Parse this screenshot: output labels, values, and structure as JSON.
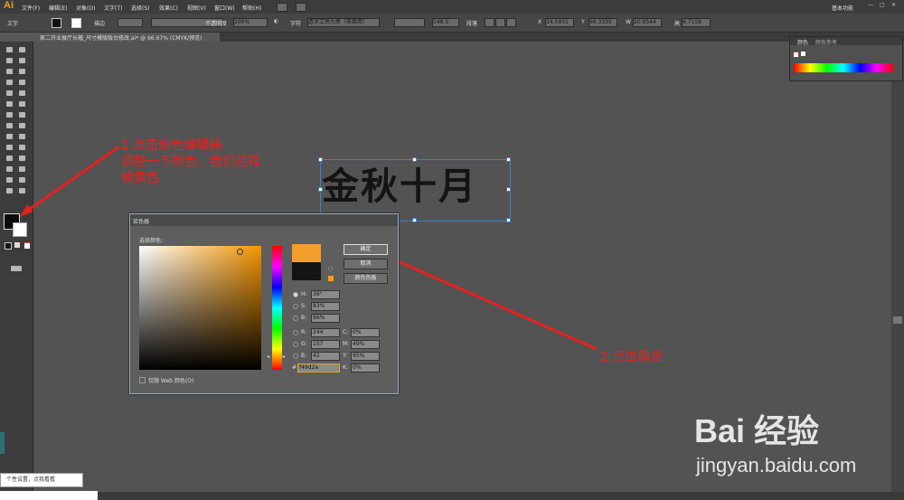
{
  "app": {
    "logo": "Ai",
    "workspace": "基本功能"
  },
  "menu": [
    "文件(F)",
    "编辑(E)",
    "对象(O)",
    "文字(T)",
    "选择(S)",
    "效果(C)",
    "视图(V)",
    "窗口(W)",
    "帮助(H)"
  ],
  "controlbar": {
    "mode": "文字",
    "stroke_label": "描边",
    "opacity_label": "不透明度",
    "opacity_value": "100%",
    "char_label": "字符",
    "font_value": "造字工房力黑（非商用）",
    "font_size": "148.5",
    "paragraph_label": "段落",
    "x": "34.5931",
    "y": "66.3335",
    "w": "20.9544",
    "h_label": "高",
    "h": "6.7159"
  },
  "document_tab": "家二开业展厅长幅_尺寸模版版台修改.ai* @ 66.67% (CMYK/预览)",
  "panels": {
    "color_tab": "颜色",
    "color_guide_tab": "颜色参考"
  },
  "artboard_text": "金秋十月",
  "annotations": {
    "step1": [
      "1.点击颜色编辑器",
      "调整一下颜色，我们选择",
      "橘黄色"
    ],
    "step2": "2.点击确定"
  },
  "color_picker": {
    "title": "拾色器",
    "select_label": "选择颜色:",
    "ok": "确定",
    "cancel": "取消",
    "swatches": "颜色色板",
    "web_only": "仅限 Web 颜色(O)",
    "hsb": [
      {
        "label": "H:",
        "value": "36°"
      },
      {
        "label": "S:",
        "value": "83%"
      },
      {
        "label": "B:",
        "value": "96%"
      }
    ],
    "rgb": [
      {
        "label": "R:",
        "value": "244"
      },
      {
        "label": "G:",
        "value": "157"
      },
      {
        "label": "B:",
        "value": "42"
      }
    ],
    "cmyk": [
      {
        "label": "C:",
        "value": "0%"
      },
      {
        "label": "M:",
        "value": "49%"
      },
      {
        "label": "Y:",
        "value": "95%"
      },
      {
        "label": "K:",
        "value": "0%"
      }
    ],
    "hex_label": "#",
    "hex": "f49d2a",
    "new_color": "#f49d2a",
    "old_color": "#141414"
  },
  "tooltip": "个性设置，点我看看",
  "watermark": {
    "brand": "Bai 经验",
    "url": "jingyan.baidu.com"
  }
}
